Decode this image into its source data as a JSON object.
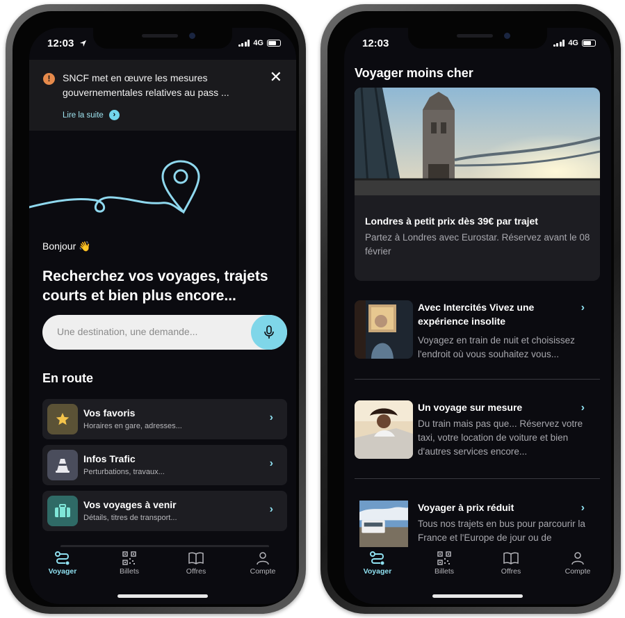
{
  "left": {
    "status": {
      "time": "12:03",
      "network": "4G"
    },
    "alert": {
      "message": "SNCF met en œuvre les mesures gouvernementales relatives au pass ...",
      "link": "Lire la suite",
      "close": "✕"
    },
    "greeting": "Bonjour 👋",
    "headline": "Recherchez vos voyages, trajets courts et bien plus encore...",
    "search": {
      "placeholder": "Une destination, une demande..."
    },
    "section_title": "En route",
    "cards": [
      {
        "title": "Vos favoris",
        "subtitle": "Horaires en gare, adresses...",
        "icon": "star-icon",
        "color": "#5b5236"
      },
      {
        "title": "Infos Trafic",
        "subtitle": "Perturbations, travaux...",
        "icon": "traffic-cone-icon",
        "color": "#4a4d5c"
      },
      {
        "title": "Vos voyages à venir",
        "subtitle": "Détails, titres de transport...",
        "icon": "suitcase-icon",
        "color": "#2f6a66"
      }
    ]
  },
  "right": {
    "status": {
      "time": "12:03",
      "network": "4G"
    },
    "section_title": "Voyager moins cher",
    "featured": {
      "title": "Londres à petit prix dès 39€ par trajet",
      "description": "Partez à Londres avec Eurostar. Réservez avant le 08 février"
    },
    "offers": [
      {
        "title": "Avec Intercités  Vivez une expérience insolite",
        "description": "Voyagez en train de nuit et choisissez l'endroit où vous souhaitez vous..."
      },
      {
        "title": "Un voyage sur mesure",
        "description": "Du train mais pas que... Réservez votre taxi, votre location de voiture et bien d'autres services encore..."
      },
      {
        "title": "Voyager à prix réduit",
        "description": "Tous nos trajets en bus pour parcourir la France et l'Europe de jour ou de"
      }
    ]
  },
  "tabs": [
    {
      "label": "Voyager",
      "icon": "route-icon",
      "active": true
    },
    {
      "label": "Billets",
      "icon": "qr-code-icon",
      "active": false
    },
    {
      "label": "Offres",
      "icon": "book-icon",
      "active": false
    },
    {
      "label": "Compte",
      "icon": "person-icon",
      "active": false
    }
  ],
  "colors": {
    "accent": "#8fe0f0",
    "background": "#0b0b10",
    "card": "#1d1d22",
    "warning": "#e68a4b"
  }
}
